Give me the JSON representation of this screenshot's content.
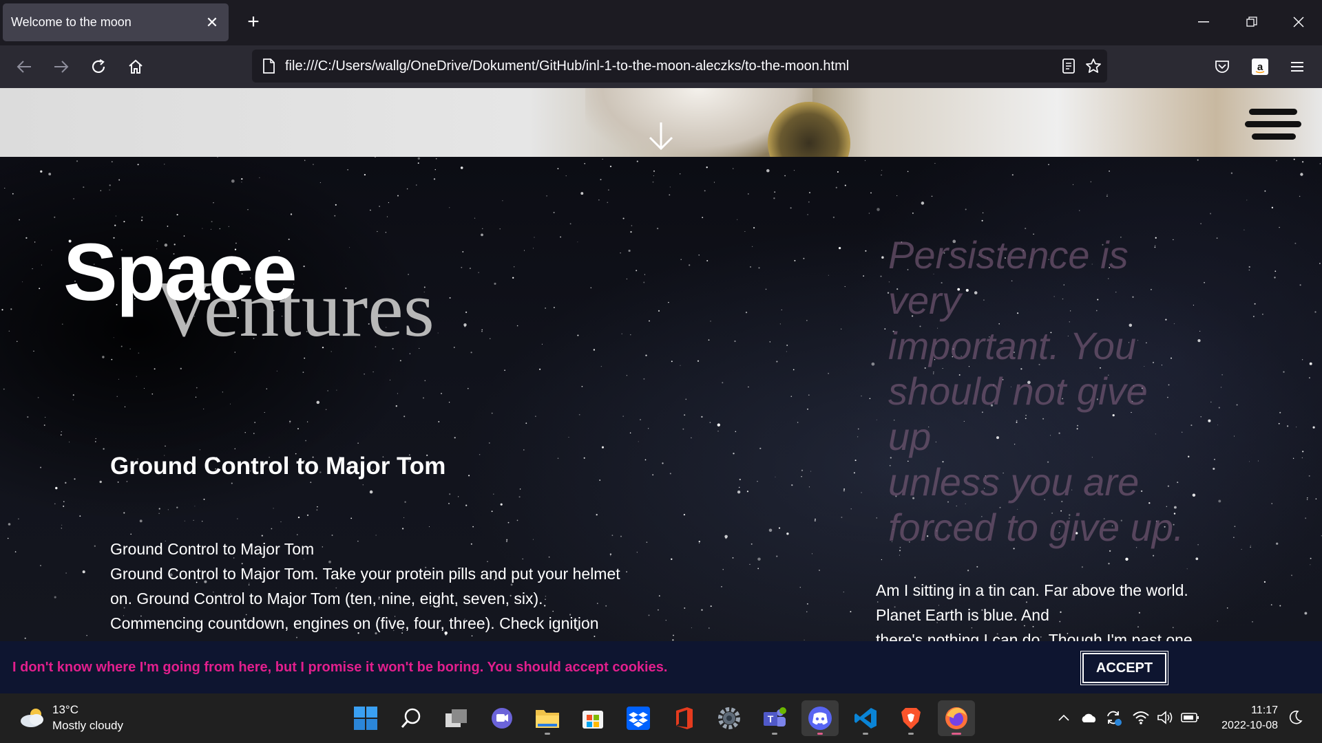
{
  "browser": {
    "tab_title": "Welcome to the moon",
    "url": "file:///C:/Users/wallg/OneDrive/Dokument/GitHub/inl-1-to-the-moon-aleczks/to-the-moon.html"
  },
  "page": {
    "title_word1": "Space",
    "title_word2": "Ventures",
    "quote_lines": [
      "Persistence is",
      "very",
      "important. You",
      "should not give",
      "up",
      "unless you are",
      "forced to give up."
    ],
    "section_title": "Ground Control to Major Tom",
    "body_lines": [
      "Ground Control to Major Tom",
      "Ground Control to Major Tom. Take your protein pills and put your helmet",
      "on. Ground Control to Major Tom (ten, nine, eight, seven, six).",
      "Commencing countdown, engines on (five, four, three). Check ignition"
    ],
    "right_lines": [
      "Am I sitting in a tin can. Far above the world.",
      "Planet Earth is blue. And",
      "there's nothing I can do. Though I'm past one"
    ],
    "cookie_text": "I don't know where I'm going from here, but I promise it won't be boring. You should accept cookies.",
    "accept_label": "ACCEPT",
    "accent_color": "#e21f8d"
  },
  "taskbar": {
    "temperature": "13°C",
    "weather": "Mostly cloudy",
    "time": "11:17",
    "date": "2022-10-08",
    "apps": [
      "start-icon",
      "search-icon",
      "task-view-icon",
      "chat-icon",
      "file-explorer-icon",
      "store-icon",
      "dropbox-icon",
      "office-icon",
      "settings-icon",
      "teams-icon",
      "discord-icon",
      "vscode-icon",
      "brave-icon",
      "firefox-icon"
    ]
  }
}
